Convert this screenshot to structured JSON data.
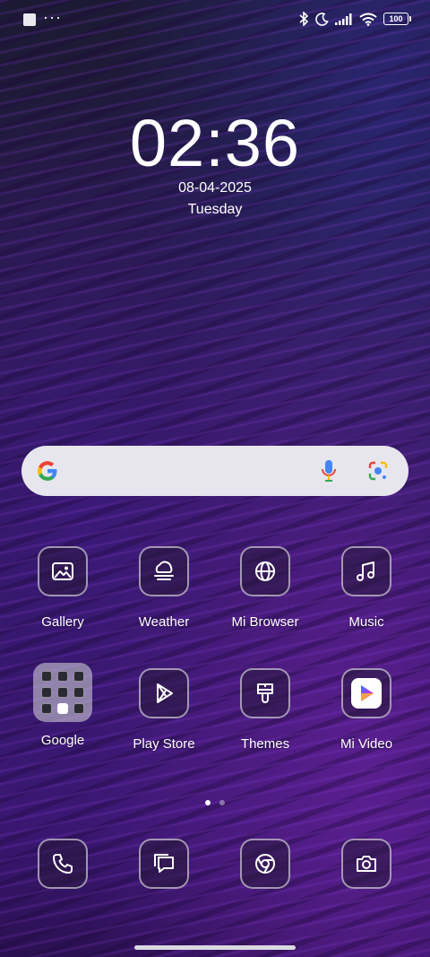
{
  "status_bar": {
    "battery_level": "100",
    "left_icons": [
      "notification-square-icon",
      "more-dots-icon"
    ],
    "right_icons": [
      "bluetooth-icon",
      "do-not-disturb-moon-icon",
      "signal-icon",
      "wifi-icon",
      "battery-icon"
    ]
  },
  "clock": {
    "time": "02:36",
    "date": "08-04-2025",
    "day": "Tuesday"
  },
  "search_bar": {
    "icons": [
      "google-g-icon",
      "microphone-icon",
      "google-lens-icon"
    ]
  },
  "apps": [
    {
      "label": "Gallery",
      "icon": "gallery-icon"
    },
    {
      "label": "Weather",
      "icon": "weather-icon"
    },
    {
      "label": "Mi Browser",
      "icon": "globe-icon"
    },
    {
      "label": "Music",
      "icon": "music-note-icon"
    },
    {
      "label": "Google",
      "icon": "folder-icon"
    },
    {
      "label": "Play Store",
      "icon": "play-store-icon"
    },
    {
      "label": "Themes",
      "icon": "brush-icon"
    },
    {
      "label": "Mi Video",
      "icon": "mi-video-icon"
    }
  ],
  "page_indicator": {
    "pages": 2,
    "active": 1
  },
  "dock": [
    {
      "icon": "phone-icon"
    },
    {
      "icon": "messages-icon"
    },
    {
      "icon": "chrome-icon"
    },
    {
      "icon": "camera-icon"
    }
  ],
  "colors": {
    "search_background": "#e7e6ee",
    "tile_border": "#ffffff",
    "wallpaper_accent": "#5a1f8f"
  }
}
